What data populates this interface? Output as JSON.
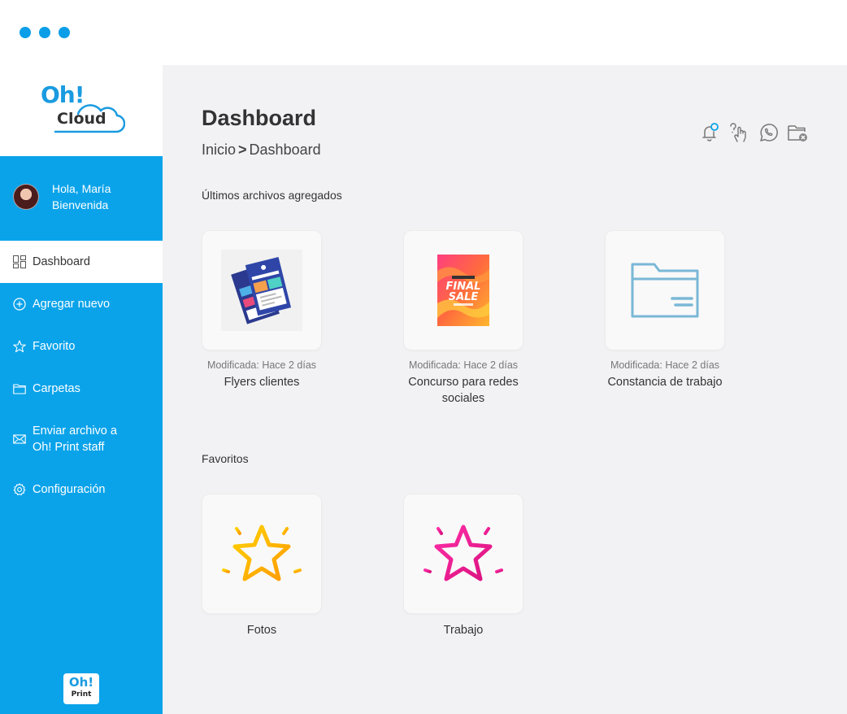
{
  "app": {
    "title": "Oh! Cloud",
    "logo_oh": "Oh!",
    "logo_cloud": "Cloud",
    "print_logo_oh": "Oh!",
    "print_logo_print": "Print",
    "accent_color": "#0aa3ea"
  },
  "user": {
    "greeting": "Hola, María",
    "subtitle": "Bienvenida"
  },
  "sidebar": {
    "items": [
      {
        "label": "Dashboard",
        "icon": "dashboard-grid-icon",
        "active": true
      },
      {
        "label": "Agregar nuevo",
        "icon": "plus-circle-icon"
      },
      {
        "label": "Favorito",
        "icon": "star-icon"
      },
      {
        "label": "Carpetas",
        "icon": "folder-icon"
      },
      {
        "label": "Enviar archivo a",
        "label2": "Oh! Print staff",
        "icon": "mail-send-icon"
      },
      {
        "label": "Configuración",
        "icon": "gear-icon"
      }
    ]
  },
  "header": {
    "title": "Dashboard",
    "breadcrumb_root": "Inicio",
    "breadcrumb_sep": ">",
    "breadcrumb_current": "Dashboard",
    "icons": [
      "notification-bell-icon",
      "help-touch-icon",
      "whatsapp-icon",
      "folder-delete-icon"
    ]
  },
  "recent": {
    "heading": "Últimos archivos agregados",
    "files": [
      {
        "meta": "Modificada: Hace 2 días",
        "name": "Flyers clientes",
        "thumb": "flyers-thumbnail"
      },
      {
        "meta": "Modificada: Hace 2 días",
        "name": "Concurso para redes",
        "name2": "sociales",
        "thumb": "final-sale-poster-thumbnail",
        "poster_line1": "FINAL",
        "poster_line2": "SALE"
      },
      {
        "meta": "Modificada: Hace 2 días",
        "name": "Constancia de trabajo",
        "thumb": "folder-icon"
      }
    ]
  },
  "favorites": {
    "heading": "Favoritos",
    "items": [
      {
        "name": "Fotos",
        "icon": "star-yellow-icon",
        "color": "#ffb000"
      },
      {
        "name": "Trabajo",
        "icon": "star-pink-icon",
        "color": "#e4198f"
      }
    ]
  }
}
